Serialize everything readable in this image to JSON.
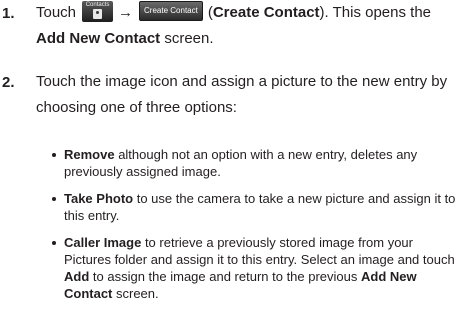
{
  "step1": {
    "number": "1.",
    "intro": "Touch",
    "contacts_icon_label": "Contacts",
    "arrow": "→",
    "button_label": "Create Contact",
    "paren_open": "(",
    "bold_label": "Create Contact",
    "paren_close": "). This opens the",
    "bold_screen": "Add New Contact",
    "screen_suffix": " screen."
  },
  "step2": {
    "number": "2.",
    "text": "Touch the image icon and assign a picture to the new entry by choosing one of three options:"
  },
  "bullets": [
    {
      "bold": "Remove",
      "text": " although not an option with a new entry, deletes any previously assigned image."
    },
    {
      "bold": "Take Photo",
      "text": " to use the camera to take a new picture and assign it to this entry."
    },
    {
      "bold": "Caller Image",
      "text": " to retrieve a previously stored image from your Pictures folder and assign it to this entry. Select an image and touch ",
      "bold2": "Add",
      "text2": " to assign the image and return to the previous ",
      "bold3": "Add New Contact",
      "text3": " screen."
    }
  ]
}
